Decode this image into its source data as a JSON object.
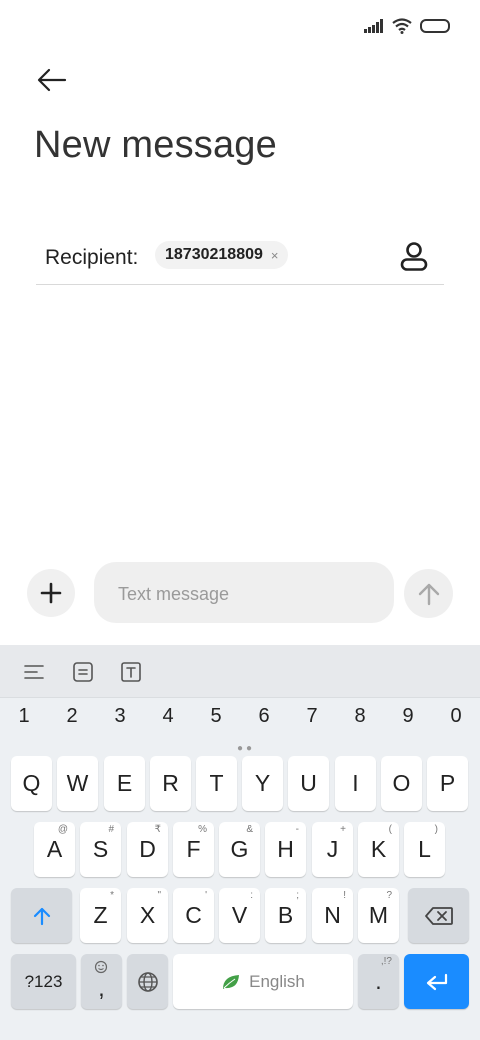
{
  "header": {
    "title": "New message"
  },
  "recipient": {
    "label": "Recipient:",
    "chip": "18730218809",
    "chip_close": "×"
  },
  "compose": {
    "placeholder": "Text message"
  },
  "keyboard": {
    "numbers": [
      "1",
      "2",
      "3",
      "4",
      "5",
      "6",
      "7",
      "8",
      "9",
      "0"
    ],
    "row1": [
      "Q",
      "W",
      "E",
      "R",
      "T",
      "Y",
      "U",
      "I",
      "O",
      "P"
    ],
    "row2": [
      {
        "key": "A",
        "hint": "@"
      },
      {
        "key": "S",
        "hint": "#"
      },
      {
        "key": "D",
        "hint": "₹"
      },
      {
        "key": "F",
        "hint": "%"
      },
      {
        "key": "G",
        "hint": "&"
      },
      {
        "key": "H",
        "hint": "-"
      },
      {
        "key": "J",
        "hint": "+"
      },
      {
        "key": "K",
        "hint": "("
      },
      {
        "key": "L",
        "hint": ")"
      }
    ],
    "row3": [
      {
        "key": "Z",
        "hint": "*"
      },
      {
        "key": "X",
        "hint": "\""
      },
      {
        "key": "C",
        "hint": "'"
      },
      {
        "key": "V",
        "hint": ":"
      },
      {
        "key": "B",
        "hint": ";"
      },
      {
        "key": "N",
        "hint": "!"
      },
      {
        "key": "M",
        "hint": "?"
      }
    ],
    "sym_label": "?123",
    "comma": ",",
    "period": ".",
    "period_hint": ",!?",
    "space_label": "English"
  },
  "colors": {
    "accent": "#1a8cff",
    "keyboard_bg": "#edf0f3"
  }
}
